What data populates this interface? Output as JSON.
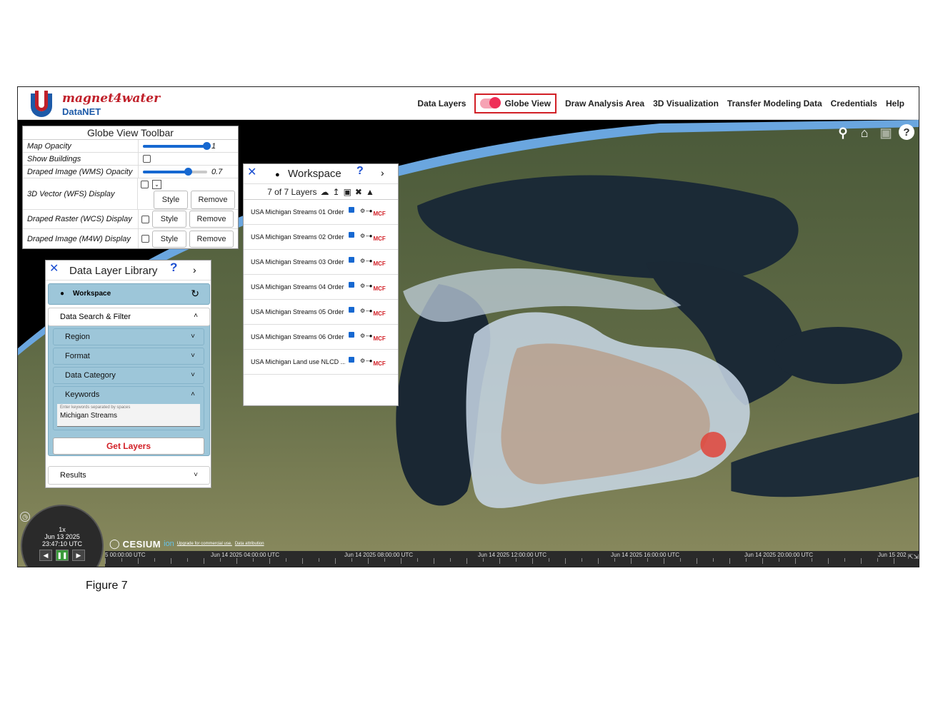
{
  "app": {
    "brand": "magnet4water",
    "sub_brand": "DataNET"
  },
  "nav": {
    "data_layers": "Data Layers",
    "globe_view": "Globe View",
    "draw_analysis_area": "Draw Analysis Area",
    "visualization_3d": "3D Visualization",
    "transfer_modeling": "Transfer Modeling Data",
    "credentials": "Credentials",
    "help": "Help"
  },
  "globe_toolbar": {
    "title": "Globe View Toolbar",
    "map_opacity_label": "Map Opacity",
    "map_opacity_value": "1",
    "show_buildings_label": "Show Buildings",
    "draped_wms_label": "Draped Image (WMS) Opacity",
    "draped_wms_value": "0.7",
    "vector_wfs_label": "3D Vector (WFS) Display",
    "raster_wcs_label": "Draped Raster (WCS) Display",
    "image_m4w_label": "Draped Image (M4W) Display",
    "style_label": "Style",
    "remove_label": "Remove"
  },
  "workspace": {
    "title": "Workspace",
    "layer_count": "7 of 7 Layers",
    "layers": [
      "USA Michigan Streams 01 Order",
      "USA Michigan Streams 02 Order",
      "USA Michigan Streams 03 Order",
      "USA Michigan Streams 04 Order",
      "USA Michigan Streams 05 Order",
      "USA Michigan Streams 06 Order",
      "USA Michigan Land use NLCD ..."
    ],
    "mcf_label": "MCF"
  },
  "library": {
    "title": "Data Layer Library",
    "workspace_label": "Workspace",
    "search_filter": "Data Search & Filter",
    "region": "Region",
    "format": "Format",
    "data_category": "Data Category",
    "keywords": "Keywords",
    "keywords_placeholder": "Enter keywords separated by spaces",
    "keywords_value": "Michigan Streams",
    "get_layers": "Get Layers",
    "results": "Results"
  },
  "clock": {
    "speed": "1x",
    "date": "Jun 13 2025",
    "time": "23:47:10 UTC"
  },
  "credits": {
    "cesium": "CESIUM",
    "ion": "ion",
    "upgrade": "Upgrade for commercial use.",
    "attribution": "Data attribution"
  },
  "timeline": {
    "labels": [
      "5 00:00:00 UTC",
      "Jun 14 2025 04:00:00 UTC",
      "Jun 14 2025 08:00:00 UTC",
      "Jun 14 2025 12:00:00 UTC",
      "Jun 14 2025 16:00:00 UTC",
      "Jun 14 2025 20:00:00 UTC",
      "Jun 15 202"
    ]
  },
  "caption": "Figure 7",
  "colors": {
    "brand_red": "#c0202a",
    "brand_blue": "#1d5aa8",
    "accent_blue": "#1668d1",
    "panel_teal": "#9dc6d9",
    "highlight_red": "#d21f26"
  }
}
